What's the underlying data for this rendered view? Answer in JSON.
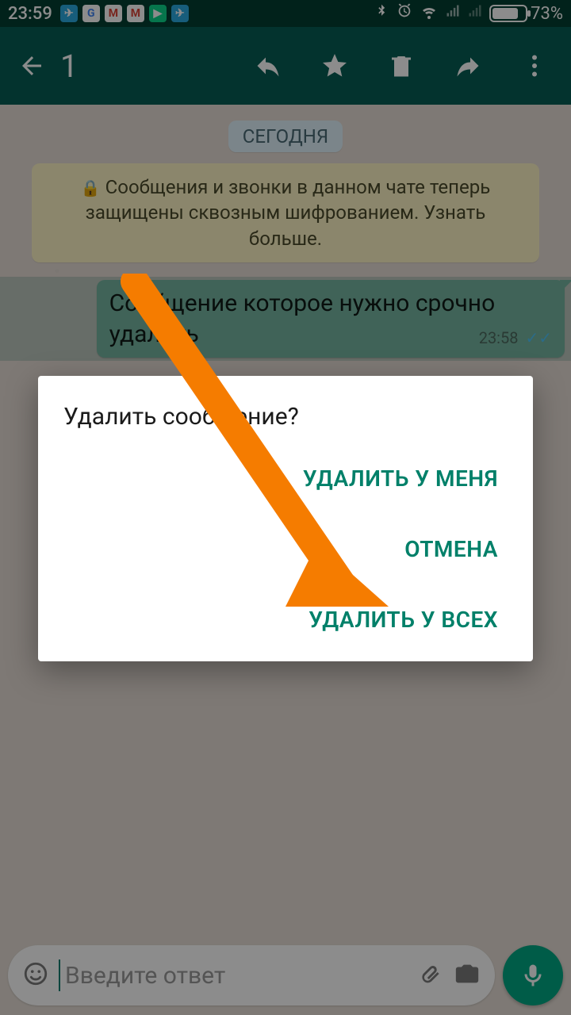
{
  "status": {
    "time": "23:59",
    "battery_pct": "73%"
  },
  "toolbar": {
    "selection_count": "1"
  },
  "chat": {
    "date_chip": "СЕГОДНЯ",
    "encryption_banner": "Сообщения и звонки в данном чате теперь защищены сквозным шифрованием. Узнать больше.",
    "message": {
      "text": "Сообщение которое нужно срочно удалить",
      "time": "23:58"
    }
  },
  "input": {
    "placeholder": "Введите ответ"
  },
  "dialog": {
    "title": "Удалить сообщение?",
    "delete_for_me": "УДАЛИТЬ У МЕНЯ",
    "cancel": "ОТМЕНА",
    "delete_for_all": "УДАЛИТЬ У ВСЕХ"
  }
}
